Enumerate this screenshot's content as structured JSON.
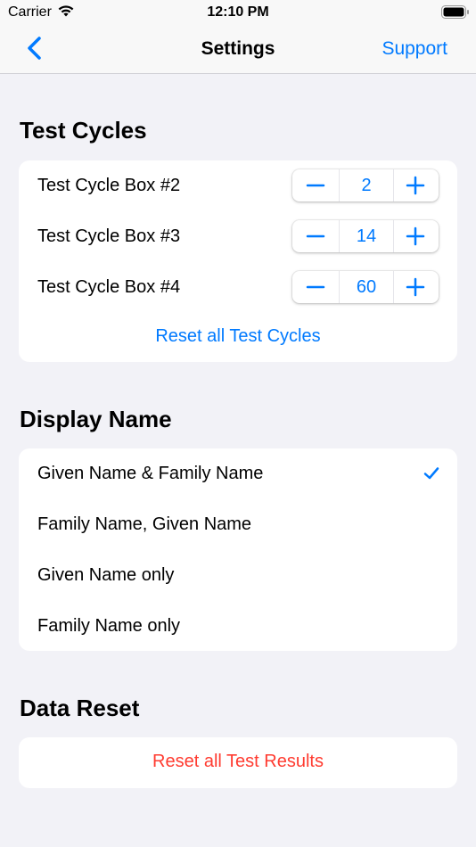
{
  "status_bar": {
    "carrier": "Carrier",
    "time": "12:10 PM",
    "icons": [
      "wifi-icon",
      "battery-icon"
    ]
  },
  "nav": {
    "back_icon": "chevron-left-icon",
    "title": "Settings",
    "support_label": "Support"
  },
  "test_cycles": {
    "title": "Test Cycles",
    "rows": [
      {
        "label": "Test Cycle Box #2",
        "value": "2"
      },
      {
        "label": "Test Cycle Box #3",
        "value": "14"
      },
      {
        "label": "Test Cycle Box #4",
        "value": "60"
      }
    ],
    "reset_label": "Reset all Test Cycles"
  },
  "display_name": {
    "title": "Display Name",
    "options": [
      {
        "label": "Given Name & Family Name",
        "selected": true
      },
      {
        "label": "Family Name, Given Name",
        "selected": false
      },
      {
        "label": "Given Name only",
        "selected": false
      },
      {
        "label": "Family Name only",
        "selected": false
      }
    ]
  },
  "data_reset": {
    "title": "Data Reset",
    "reset_label": "Reset all Test Results"
  },
  "colors": {
    "accent": "#007aff",
    "destructive": "#ff3b30",
    "background": "#f2f2f7"
  }
}
